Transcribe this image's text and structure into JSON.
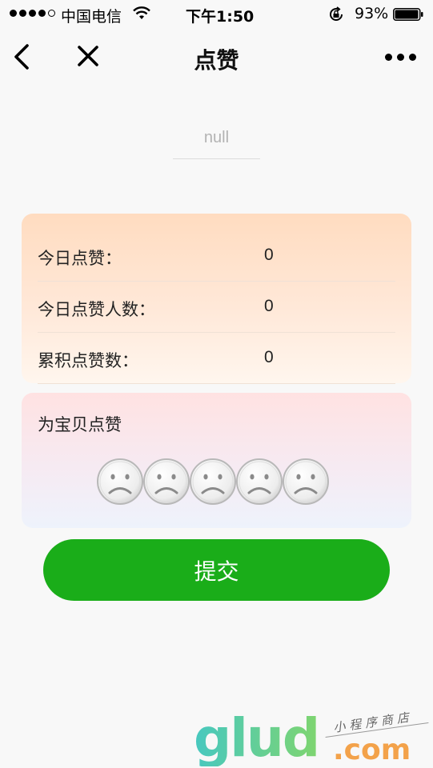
{
  "status_bar": {
    "carrier": "中国电信",
    "time": "下午1:50",
    "battery": "93%"
  },
  "nav": {
    "title": "点赞",
    "back_icon": "chevron-left-icon",
    "close_icon": "close-icon",
    "more_icon": "more-dots-icon"
  },
  "input": {
    "placeholder": "null"
  },
  "stats": [
    {
      "label": "今日点赞：",
      "value": "0"
    },
    {
      "label": "今日点赞人数：",
      "value": "0"
    },
    {
      "label": "累积点赞数：",
      "value": "0"
    }
  ],
  "rating": {
    "title": "为宝贝点赞",
    "max": 5,
    "selected": 0,
    "face_icon": "sad-face-icon"
  },
  "submit": {
    "label": "提交",
    "color": "#1aad19"
  },
  "watermark": {
    "logo": "glud",
    "domain": ".com",
    "tagline": "小程序商店"
  }
}
